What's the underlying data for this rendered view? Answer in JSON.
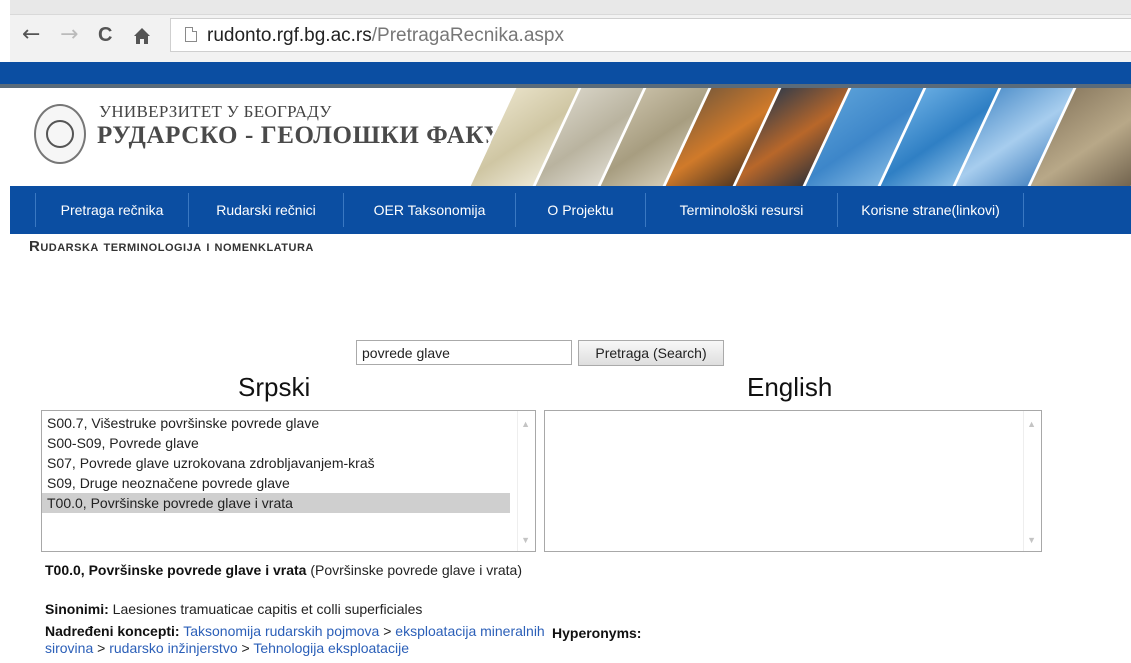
{
  "browser": {
    "back": "←",
    "forward": "→",
    "reload": "C",
    "home": "🏠",
    "url_host": "rudonto.rgf.bg.ac.rs",
    "url_path": "/PretragaRecnika.aspx"
  },
  "header": {
    "university": "УНИВЕРЗИТЕТ У БЕОГРАДУ",
    "faculty": "РУДАРСКО - ГЕОЛОШКИ ФАКУЛТЕТ"
  },
  "menu": {
    "items": [
      {
        "label": "Pretraga rečnika"
      },
      {
        "label": "Rudarski rečnici"
      },
      {
        "label": "OER Taksonomija"
      },
      {
        "label": "O Projektu"
      },
      {
        "label": "Terminološki resursi"
      },
      {
        "label": "Korisne strane(linkovi)"
      }
    ]
  },
  "section_title": "Rudarska terminologija i nomenklatura",
  "search": {
    "value": "povrede glave",
    "button_label": "Pretraga (Search)"
  },
  "serbian": {
    "title": "Srpski",
    "options": [
      "S00.7, Višestruke površinske povrede glave",
      "S00-S09, Povrede glave",
      "S07, Povrede glave uzrokovana zdrobljavanjem-kraš",
      "S09, Druge neoznačene povrede glave",
      "T00.0, Površinske povrede glave i vrata"
    ],
    "selected_index": 4
  },
  "english": {
    "title": "English",
    "options": []
  },
  "detail": {
    "term_bold": "T00.0, Površinske povrede glave i vrata",
    "term_rest": " (Površinske povrede glave i vrata)",
    "synonyms_label": "Sinonimi:",
    "synonyms_value": " Laesiones tramuaticae capitis et colli superficiales",
    "broader_label": "Nadređeni koncepti:",
    "broader_links": [
      "Taksonomija rudarskih pojmova",
      "eksploatacija mineralnih sirovina",
      "rudarsko inžinjerstvo",
      "Tehnologija eksploatacije"
    ],
    "separator": " > ",
    "hyperonyms_label": "Hyperonyms:"
  },
  "colors": {
    "brand_blue": "#0b4ea2",
    "link_blue": "#2b5fb8",
    "selected_bg": "#cfcfcf"
  }
}
